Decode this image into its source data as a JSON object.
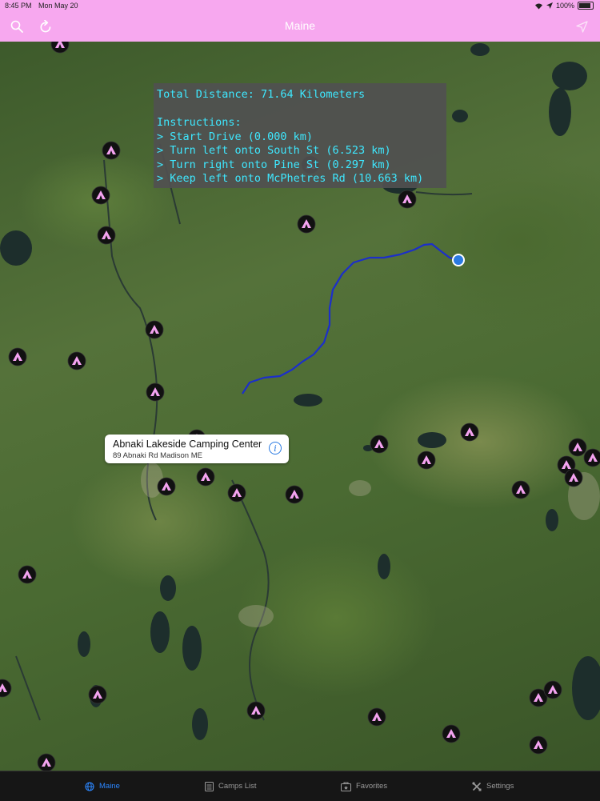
{
  "status_bar": {
    "time": "8:45 PM",
    "date": "Mon May 20",
    "battery": "100%"
  },
  "nav": {
    "title": "Maine",
    "search_icon": "search-icon",
    "refresh_icon": "refresh-icon",
    "location_icon": "location-arrow-icon"
  },
  "directions": {
    "total": "Total Distance: 71.64 Kilometers",
    "heading": "Instructions:",
    "steps": [
      "> Start Drive (0.000 km)",
      "> Turn left onto South St (6.523 km)",
      "> Turn right onto Pine St (0.297 km)",
      "> Keep left onto McPhetres Rd (10.663 km)"
    ]
  },
  "callout": {
    "name": "Abnaki Lakeside Camping Center",
    "address": "89 Abnaki Rd Madison ME",
    "info_icon": "info-icon"
  },
  "map": {
    "route_color": "#1c2fc9",
    "pin_color": "#f4a3f0",
    "location_dot_color": "#2a7ae2",
    "campsite_marker_count": 40
  },
  "tabs": [
    {
      "label": "Maine",
      "icon": "globe-icon",
      "active": true
    },
    {
      "label": "Camps List",
      "icon": "list-icon",
      "active": false
    },
    {
      "label": "Favorites",
      "icon": "favorites-icon",
      "active": false
    },
    {
      "label": "Settings",
      "icon": "settings-icon",
      "active": false
    }
  ],
  "colors": {
    "accent": "#f7a8ef",
    "tab_active": "#2b86ff",
    "instructions_text": "#3ee8ff"
  }
}
